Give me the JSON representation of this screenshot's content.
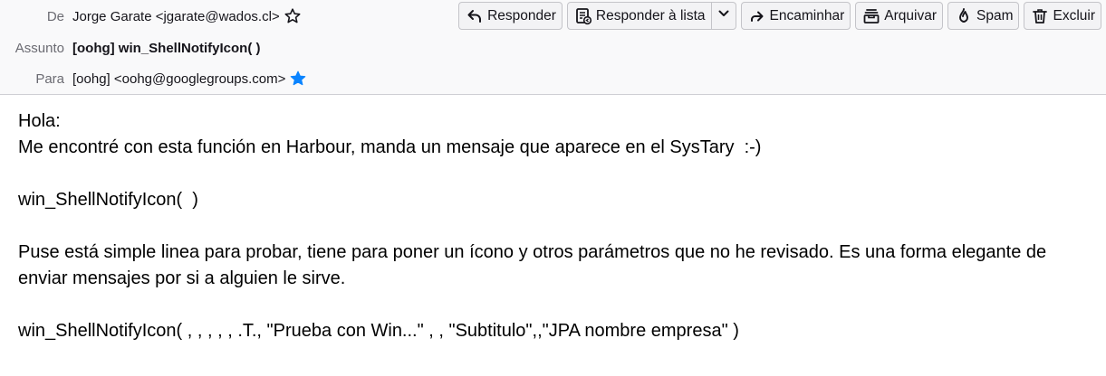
{
  "header": {
    "from_label": "De",
    "from_value": "Jorge Garate <jgarate@wados.cl>",
    "subject_label": "Assunto",
    "subject_value": "[oohg] win_ShellNotifyIcon( )",
    "to_label": "Para",
    "to_value": "[oohg] <oohg@googlegroups.com>"
  },
  "toolbar": {
    "reply": "Responder",
    "reply_list": "Responder à lista",
    "forward": "Encaminhar",
    "archive": "Arquivar",
    "spam": "Spam",
    "delete": "Excluir"
  },
  "message": {
    "line1": "Hola:",
    "line2": "Me encontré con esta función en Harbour, manda un mensaje que aparece en el SysTary  :-)",
    "line3": "win_ShellNotifyIcon(  )",
    "line4": "Puse está simple linea para probar,  tiene para poner un ícono y otros parámetros que no he revisado. Es una forma elegante de enviar mensajes por si a alguien le sirve.",
    "line5": "win_ShellNotifyIcon( , , , , , .T., \"Prueba con Win...\" , , \"Subtitulo\",,\"JPA nombre empresa\" )"
  },
  "colors": {
    "accent_star": "#0a84ff",
    "header_bg": "#f9f9fa"
  }
}
